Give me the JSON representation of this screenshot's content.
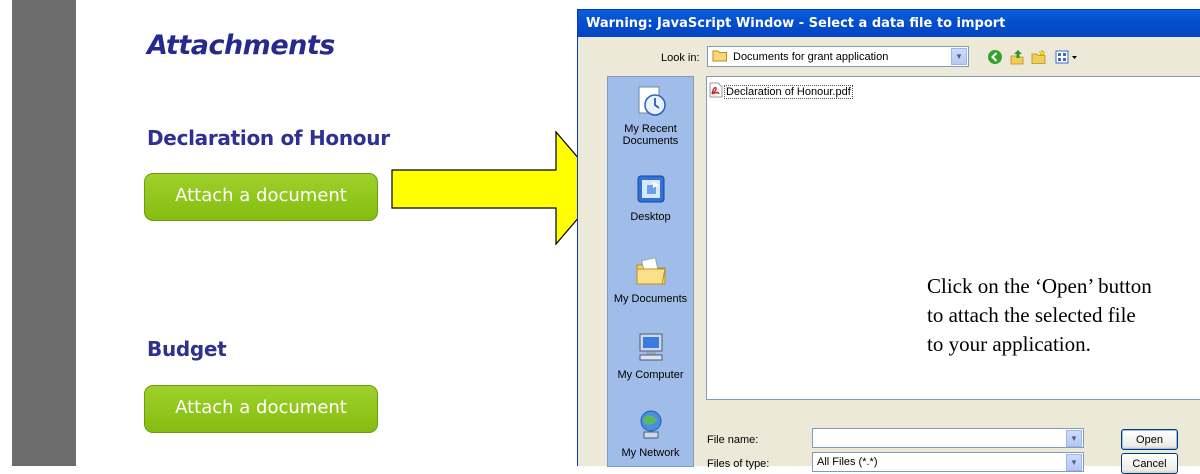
{
  "page": {
    "heading": "Attachments",
    "sections": [
      {
        "title": "Declaration of Honour",
        "button_label": "Attach a document"
      },
      {
        "title": "Budget",
        "button_label": "Attach a document"
      }
    ]
  },
  "dialog": {
    "title": "Warning: JavaScript Window - Select a data file to import",
    "look_in_label": "Look in:",
    "look_in_value": "Documents for grant application",
    "places": [
      "My Recent Documents",
      "Desktop",
      "My Documents",
      "My Computer",
      "My Network"
    ],
    "files": [
      {
        "name": "Declaration of Honour.pdf"
      }
    ],
    "file_name_label": "File name:",
    "file_name_value": "",
    "files_of_type_label": "Files of type:",
    "files_of_type_value": "All Files (*.*)",
    "open_label": "Open",
    "cancel_label": "Cancel"
  },
  "annotation": {
    "lines": [
      "Click on the ‘Open’ button",
      "to attach the selected file",
      "to your application."
    ]
  },
  "colors": {
    "heading": "#262a8e",
    "button_green": "#8fc31f",
    "arrow_fill": "#ffff00",
    "titlebar": "#0a5fd9"
  }
}
